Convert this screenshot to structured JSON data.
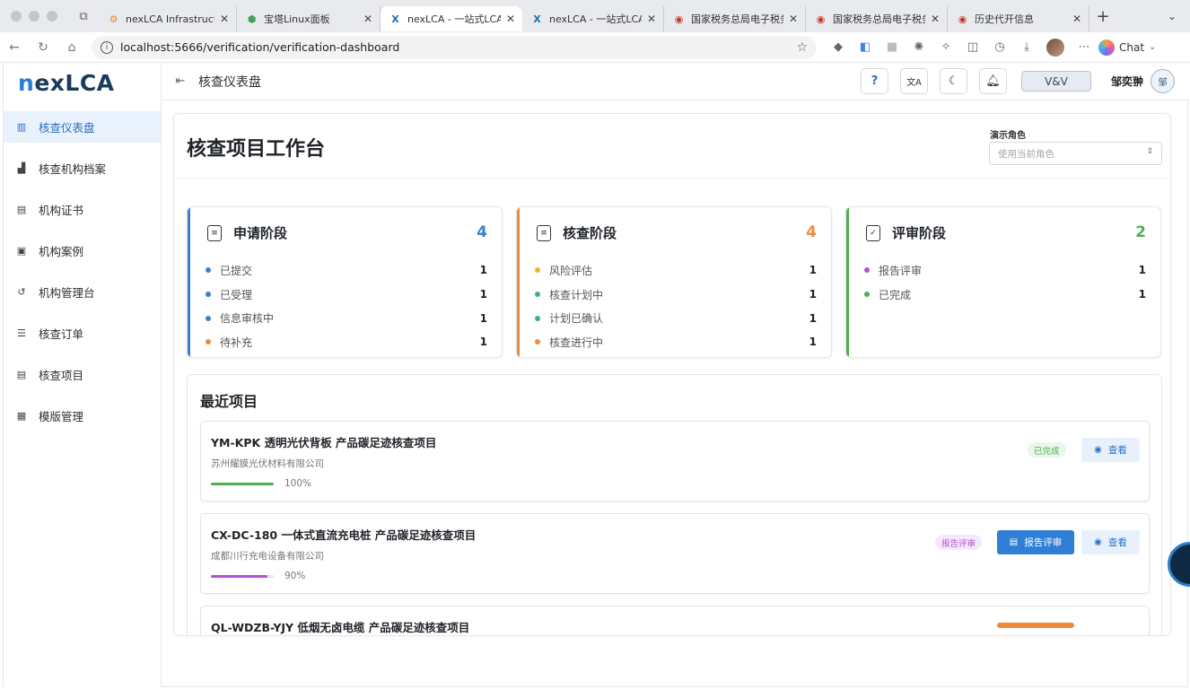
{
  "browser": {
    "tabs": [
      {
        "title": "nexLCA Infrastructure",
        "icon": "gear-orange-icon",
        "active": false
      },
      {
        "title": "宝塔Linux面板",
        "icon": "bt-panel-icon",
        "active": false
      },
      {
        "title": "nexLCA - 一站式LCA/E",
        "icon": "nexlca-x-icon",
        "active": true
      },
      {
        "title": "nexLCA - 一站式LCA/E",
        "icon": "nexlca-x-icon",
        "active": false
      },
      {
        "title": "国家税务总局电子税务局",
        "icon": "tax-emblem-icon",
        "active": false
      },
      {
        "title": "国家税务总局电子税务局",
        "icon": "tax-emblem-icon",
        "active": false
      },
      {
        "title": "历史代开信息",
        "icon": "tax-emblem-icon",
        "active": false
      }
    ],
    "url": "localhost:5666/verification/verification-dashboard",
    "chat_label": "Chat"
  },
  "app": {
    "brand": {
      "first": "n",
      "rest": "exLCA"
    },
    "breadcrumb": "核查仪表盘",
    "top_actions": {
      "help": "?",
      "translate": "文A",
      "role_badge": "V&V",
      "user_name": "邹奕翀",
      "user_avatar": "邹"
    },
    "sidebar": {
      "items": [
        {
          "label": "核查仪表盘",
          "icon": "bar-chart-icon",
          "active": true
        },
        {
          "label": "核查机构档案",
          "icon": "factory-icon",
          "active": false
        },
        {
          "label": "机构证书",
          "icon": "document-icon",
          "active": false
        },
        {
          "label": "机构案例",
          "icon": "clipboard-icon",
          "active": false
        },
        {
          "label": "机构管理台",
          "icon": "refresh-settings-icon",
          "active": false
        },
        {
          "label": "核查订单",
          "icon": "list-icon",
          "active": false
        },
        {
          "label": "核查项目",
          "icon": "file-icon",
          "active": false
        },
        {
          "label": "模版管理",
          "icon": "template-icon",
          "active": false
        }
      ]
    },
    "page": {
      "title": "核查项目工作台",
      "role_label": "演示角色",
      "role_placeholder": "使用当前角色"
    },
    "stages": [
      {
        "title": "申请阶段",
        "count": "4",
        "color": "#3a7fd0",
        "icon": "clipboard-check-icon",
        "rows": [
          {
            "label": "已提交",
            "value": "1",
            "dot": "#3a7fd0"
          },
          {
            "label": "已受理",
            "value": "1",
            "dot": "#3a7fd0"
          },
          {
            "label": "信息审核中",
            "value": "1",
            "dot": "#3a7fd0"
          },
          {
            "label": "待补充",
            "value": "1",
            "dot": "#ef8a3a"
          }
        ]
      },
      {
        "title": "核查阶段",
        "count": "4",
        "color": "#ef8a3a",
        "icon": "clipboard-search-icon",
        "rows": [
          {
            "label": "风险评估",
            "value": "1",
            "dot": "#f0b429"
          },
          {
            "label": "核查计划中",
            "value": "1",
            "dot": "#3fb27f"
          },
          {
            "label": "计划已确认",
            "value": "1",
            "dot": "#3fb27f"
          },
          {
            "label": "核查进行中",
            "value": "1",
            "dot": "#ef8a3a"
          }
        ]
      },
      {
        "title": "评审阶段",
        "count": "2",
        "color": "#4caf50",
        "icon": "file-check-icon",
        "rows": [
          {
            "label": "报告评审",
            "value": "1",
            "dot": "#b44fd6"
          },
          {
            "label": "已完成",
            "value": "1",
            "dot": "#4caf50"
          }
        ]
      }
    ],
    "recent": {
      "title": "最近项目",
      "projects": [
        {
          "name": "YM-KPK 透明光伏背板 产品碳足迹核查项目",
          "org": "苏州耀膜光伏材料有限公司",
          "progress": 100,
          "progress_label": "100%",
          "progress_color": "#4caf50",
          "status": "已完成",
          "status_bg": "#eaf7ea",
          "status_fg": "#4caf50",
          "actions": [
            {
              "label": "查看",
              "kind": "view"
            }
          ]
        },
        {
          "name": "CX-DC-180 一体式直流充电桩 产品碳足迹核查项目",
          "org": "成都川行充电设备有限公司",
          "progress": 90,
          "progress_label": "90%",
          "progress_color": "#b44fd6",
          "status": "报告评审",
          "status_bg": "#f6e8fb",
          "status_fg": "#b44fd6",
          "actions": [
            {
              "label": "报告评审",
              "kind": "review"
            },
            {
              "label": "查看",
              "kind": "view"
            }
          ]
        },
        {
          "name": "QL-WDZB-YJY 低烟无卤电缆 产品碳足迹核查项目",
          "org": "",
          "progress": 0,
          "progress_label": "",
          "progress_color": "#ef8a3a",
          "status": "",
          "status_bg": "#fdf0e3",
          "status_fg": "#ef8a3a",
          "actions": []
        }
      ]
    }
  }
}
